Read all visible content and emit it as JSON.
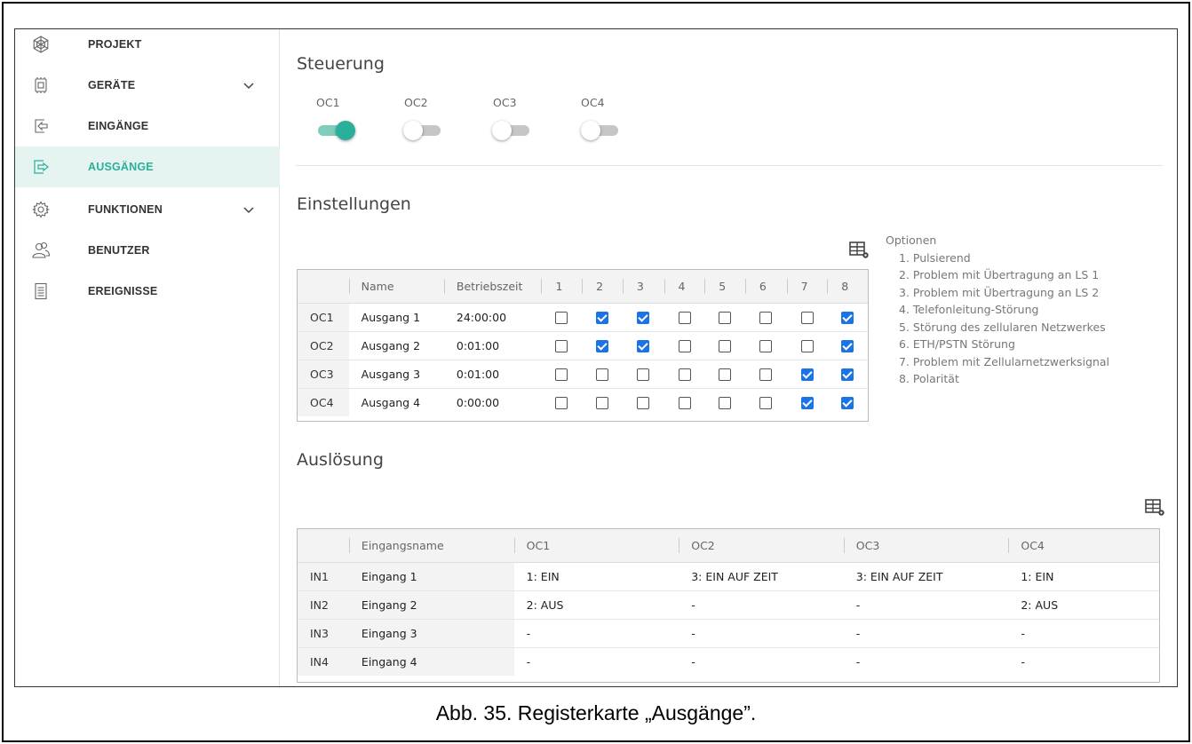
{
  "sidebar": {
    "items": [
      {
        "label": "PROJEKT",
        "icon": "snowflake-icon",
        "active": false,
        "expandable": false
      },
      {
        "label": "GERÄTE",
        "icon": "device-icon",
        "active": false,
        "expandable": true
      },
      {
        "label": "EINGÄNGE",
        "icon": "input-arrow-icon",
        "active": false,
        "expandable": false
      },
      {
        "label": "AUSGÄNGE",
        "icon": "output-arrow-icon",
        "active": true,
        "expandable": false
      },
      {
        "label": "FUNKTIONEN",
        "icon": "gear-icon",
        "active": false,
        "expandable": true
      },
      {
        "label": "BENUTZER",
        "icon": "users-icon",
        "active": false,
        "expandable": false
      },
      {
        "label": "EREIGNISSE",
        "icon": "document-icon",
        "active": false,
        "expandable": false
      }
    ]
  },
  "steuerung": {
    "title": "Steuerung",
    "toggles": [
      {
        "label": "OC1",
        "on": true
      },
      {
        "label": "OC2",
        "on": false
      },
      {
        "label": "OC3",
        "on": false
      },
      {
        "label": "OC4",
        "on": false
      }
    ]
  },
  "einstellungen": {
    "title": "Einstellungen",
    "headers": {
      "name": "Name",
      "time": "Betriebszeit",
      "options": [
        "1",
        "2",
        "3",
        "4",
        "5",
        "6",
        "7",
        "8"
      ]
    },
    "rows": [
      {
        "id": "OC1",
        "name": "Ausgang 1",
        "time": "24:00:00",
        "checks": [
          false,
          true,
          true,
          false,
          false,
          false,
          false,
          true
        ]
      },
      {
        "id": "OC2",
        "name": "Ausgang 2",
        "time": "0:01:00",
        "checks": [
          false,
          true,
          true,
          false,
          false,
          false,
          false,
          true
        ]
      },
      {
        "id": "OC3",
        "name": "Ausgang 3",
        "time": "0:01:00",
        "checks": [
          false,
          false,
          false,
          false,
          false,
          false,
          true,
          true
        ]
      },
      {
        "id": "OC4",
        "name": "Ausgang 4",
        "time": "0:00:00",
        "checks": [
          false,
          false,
          false,
          false,
          false,
          false,
          true,
          true
        ]
      }
    ],
    "options_legend": {
      "title": "Optionen",
      "items": [
        "1. Pulsierend",
        "2. Problem mit Übertragung an LS 1",
        "3. Problem mit Übertragung an LS 2",
        "4. Telefonleitung-Störung",
        "5. Störung des zellularen Netzwerkes",
        "6. ETH/PSTN Störung",
        "7. Problem mit Zellularnetzwerksignal",
        "8. Polarität"
      ]
    }
  },
  "ausloesung": {
    "title": "Auslösung",
    "headers": {
      "name": "Eingangsname",
      "cols": [
        "OC1",
        "OC2",
        "OC3",
        "OC4"
      ]
    },
    "rows": [
      {
        "id": "IN1",
        "name": "Eingang 1",
        "values": [
          "1: EIN",
          "3: EIN AUF ZEIT",
          "3: EIN AUF ZEIT",
          "1: EIN"
        ]
      },
      {
        "id": "IN2",
        "name": "Eingang 2",
        "values": [
          "2: AUS",
          "-",
          "-",
          "2: AUS"
        ]
      },
      {
        "id": "IN3",
        "name": "Eingang 3",
        "values": [
          "-",
          "-",
          "-",
          "-"
        ]
      },
      {
        "id": "IN4",
        "name": "Eingang 4",
        "values": [
          "-",
          "-",
          "-",
          "-"
        ]
      }
    ]
  },
  "caption": "Abb. 35. Registerkarte „Ausgänge”.",
  "colors": {
    "accent": "#2ab09a",
    "active_bg": "#e6f4f1",
    "checkbox": "#1a73e8"
  }
}
